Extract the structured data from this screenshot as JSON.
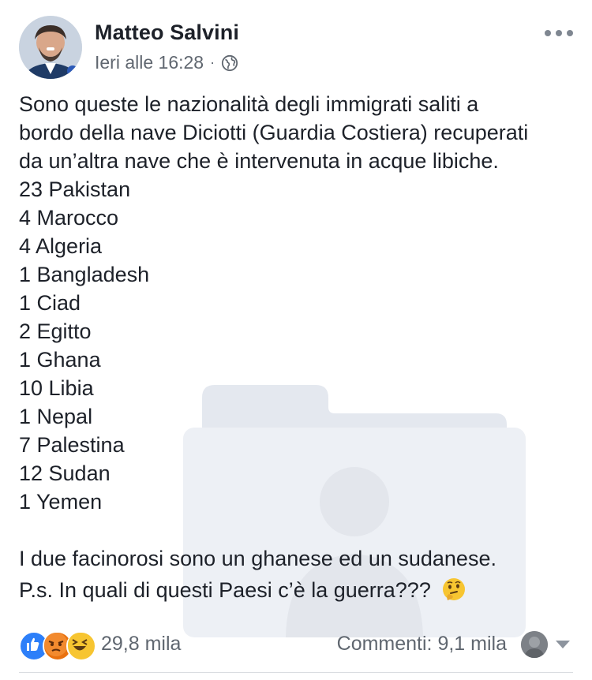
{
  "post": {
    "author": "Matteo Salvini",
    "timestamp": "Ieri alle 16:28",
    "separator": "·",
    "audience_icon": "globe-icon",
    "menu_icon": "more-options-icon"
  },
  "content": {
    "intro": [
      "Sono queste le nazionalità degli immigrati saliti a",
      "bordo della nave Diciotti (Guardia Costiera) recuperati",
      "da un’altra nave che è intervenuta in acque libiche."
    ],
    "nationalities": [
      "23 Pakistan",
      "4 Marocco",
      "4 Algeria",
      "1 Bangladesh",
      "1 Ciad",
      "2 Egitto",
      "1 Ghana",
      "10 Libia",
      "1 Nepal",
      "7 Palestina",
      "12 Sudan",
      "1 Yemen"
    ],
    "closing": "I due facinorosi sono un ghanese ed un sudanese.",
    "ps": "P.s. In quali di questi Paesi c’è la guerra???",
    "ps_emoji": "thinking-face-icon"
  },
  "footer": {
    "reactions": [
      "like-icon",
      "angry-icon",
      "laughing-icon"
    ],
    "reaction_count": "29,8 mila",
    "comments": "Commenti: 9,1 mila"
  },
  "colors": {
    "text": "#1d2129",
    "meta": "#606770",
    "like": "#2d7ff9",
    "angry": "#e9710f",
    "haha": "#f7c531"
  }
}
